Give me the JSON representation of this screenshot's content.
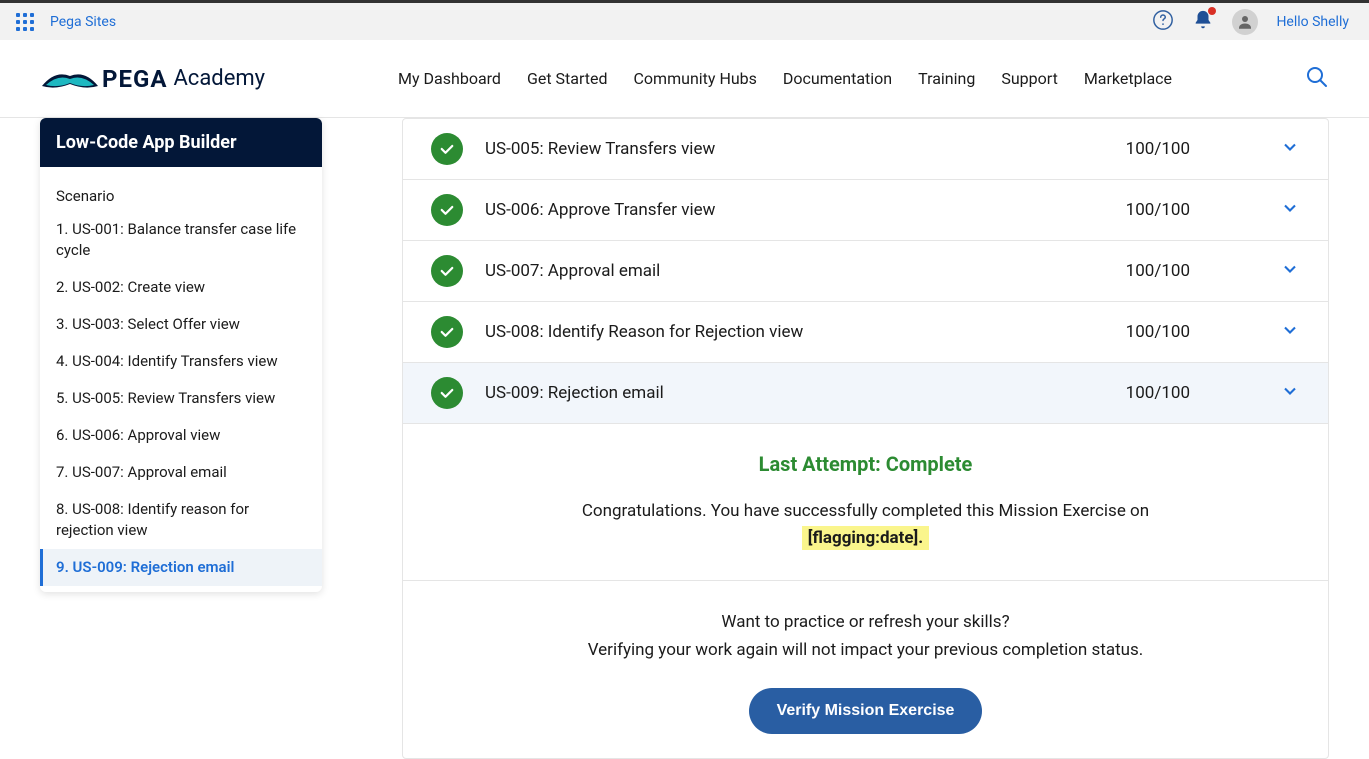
{
  "topbar": {
    "sites_label": "Pega Sites",
    "greeting": "Hello Shelly"
  },
  "header": {
    "logo_text": "PEGA",
    "logo_sub": "Academy",
    "nav": [
      {
        "label": "My Dashboard"
      },
      {
        "label": "Get Started"
      },
      {
        "label": "Community Hubs"
      },
      {
        "label": "Documentation"
      },
      {
        "label": "Training"
      },
      {
        "label": "Support"
      },
      {
        "label": "Marketplace"
      }
    ]
  },
  "sidebar": {
    "title": "Low-Code App Builder",
    "scenario_label": "Scenario",
    "items": [
      {
        "label": "1. US-001: Balance transfer case life cycle"
      },
      {
        "label": "2. US-002: Create view"
      },
      {
        "label": "3. US-003: Select Offer view"
      },
      {
        "label": "4. US-004: Identify Transfers view"
      },
      {
        "label": "5. US-005: Review Transfers view"
      },
      {
        "label": "6. US-006: Approval view"
      },
      {
        "label": "7. US-007: Approval email"
      },
      {
        "label": "8. US-008: Identify reason for rejection view"
      },
      {
        "label": "9. US-009: Rejection email",
        "active": true
      }
    ]
  },
  "results": {
    "rows": [
      {
        "name": "US-005: Review Transfers view",
        "score": "100/100"
      },
      {
        "name": "US-006: Approve Transfer view",
        "score": "100/100"
      },
      {
        "name": "US-007: Approval email",
        "score": "100/100"
      },
      {
        "name": "US-008: Identify Reason for Rejection view",
        "score": "100/100"
      },
      {
        "name": "US-009: Rejection email",
        "score": "100/100",
        "selected": true
      }
    ],
    "status_title": "Last Attempt: Complete",
    "congrats_line1": "Congratulations. You have successfully completed this Mission Exercise on",
    "flagged_date": "[flagging:date].",
    "practice_q": "Want to practice or refresh your skills?",
    "practice_note": "Verifying your work again will not impact your previous completion status.",
    "verify_label": "Verify Mission Exercise"
  }
}
